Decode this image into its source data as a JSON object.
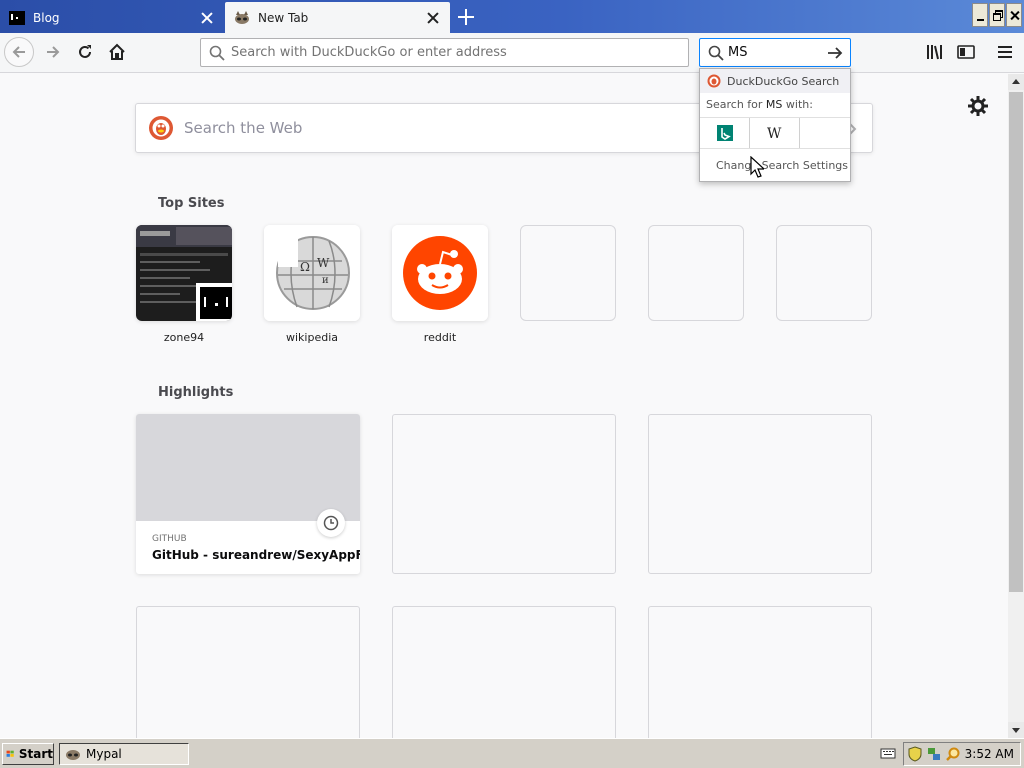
{
  "tabs": [
    {
      "title": "Blog",
      "active": false
    },
    {
      "title": "New Tab",
      "active": true
    }
  ],
  "navbar": {
    "url_placeholder": "Search with DuckDuckGo or enter address",
    "search_value": "MS"
  },
  "search_popup": {
    "engine_name": "DuckDuckGo Search",
    "search_for_prefix": "Search for ",
    "search_term": "MS",
    "search_for_suffix": " with:",
    "engines": [
      "bing-icon",
      "wikipedia-icon"
    ],
    "settings_label": "Change Search Settings"
  },
  "newtab": {
    "web_search_placeholder": "Search the Web",
    "top_sites_title": "Top Sites",
    "top_sites": [
      {
        "label": "zone94",
        "icon": "zone94-thumbnail"
      },
      {
        "label": "wikipedia",
        "icon": "wikipedia-globe-icon"
      },
      {
        "label": "reddit",
        "icon": "reddit-icon"
      },
      {
        "label": "",
        "icon": ""
      },
      {
        "label": "",
        "icon": ""
      },
      {
        "label": "",
        "icon": ""
      }
    ],
    "highlights_title": "Highlights",
    "highlights": [
      {
        "host": "GITHUB",
        "title": "GitHub - sureandrew/SexyAppF..."
      }
    ]
  },
  "taskbar": {
    "start_label": "Start",
    "task_label": "Mypal",
    "clock": "3:52 AM"
  },
  "colors": {
    "accent": "#0a84ff",
    "reddit": "#ff4500",
    "titlebar": "#2b4ea8",
    "taskbar": "#d4d0c8"
  }
}
